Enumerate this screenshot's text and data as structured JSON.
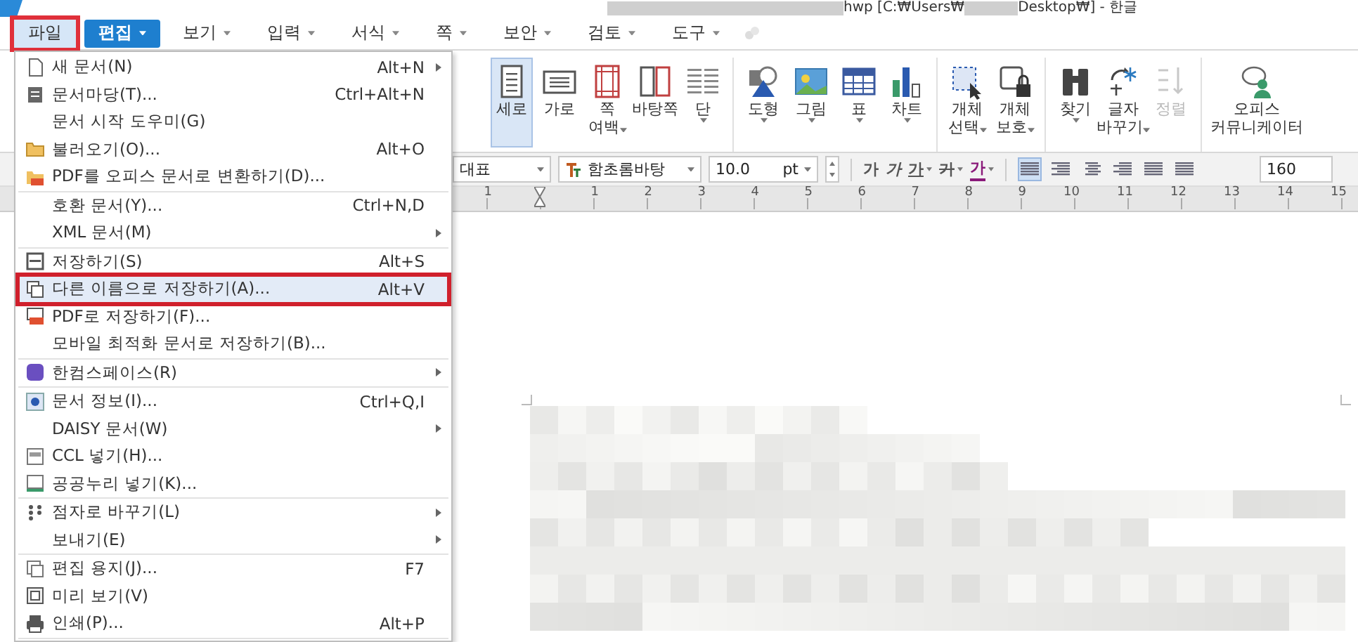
{
  "window": {
    "title_parts": [
      "hwp [C:₩Users₩",
      "Desktop₩] - 한글"
    ]
  },
  "menu_bar": [
    {
      "label": "파일",
      "selected": false,
      "open": true,
      "dropdown": false,
      "annotated": true
    },
    {
      "label": "편집",
      "selected": true,
      "open": false,
      "dropdown": true,
      "annotated": false
    },
    {
      "label": "보기",
      "selected": false,
      "open": false,
      "dropdown": true,
      "annotated": false
    },
    {
      "label": "입력",
      "selected": false,
      "open": false,
      "dropdown": true,
      "annotated": false
    },
    {
      "label": "서식",
      "selected": false,
      "open": false,
      "dropdown": true,
      "annotated": false
    },
    {
      "label": "쪽",
      "selected": false,
      "open": false,
      "dropdown": true,
      "annotated": false
    },
    {
      "label": "보안",
      "selected": false,
      "open": false,
      "dropdown": true,
      "annotated": false
    },
    {
      "label": "검토",
      "selected": false,
      "open": false,
      "dropdown": true,
      "annotated": false
    },
    {
      "label": "도구",
      "selected": false,
      "open": false,
      "dropdown": true,
      "annotated": false
    }
  ],
  "ribbon": {
    "groups": [
      [
        {
          "lines": [
            "세로"
          ],
          "dropdown": false,
          "selected": true,
          "disabled": false
        },
        {
          "lines": [
            "가로"
          ],
          "dropdown": false,
          "selected": false,
          "disabled": false
        },
        {
          "lines": [
            "쪽",
            "여백"
          ],
          "dropdown": true,
          "selected": false,
          "disabled": false
        },
        {
          "lines": [
            "바탕쪽"
          ],
          "dropdown": false,
          "selected": false,
          "disabled": false
        },
        {
          "lines": [
            "단"
          ],
          "dropdown": true,
          "selected": false,
          "disabled": false
        }
      ],
      [
        {
          "lines": [
            "도형"
          ],
          "dropdown": true,
          "selected": false,
          "disabled": false
        },
        {
          "lines": [
            "그림"
          ],
          "dropdown": true,
          "selected": false,
          "disabled": false
        },
        {
          "lines": [
            "표"
          ],
          "dropdown": true,
          "selected": false,
          "disabled": false
        },
        {
          "lines": [
            "차트"
          ],
          "dropdown": true,
          "selected": false,
          "disabled": false
        }
      ],
      [
        {
          "lines": [
            "개체",
            "선택"
          ],
          "dropdown": true,
          "selected": false,
          "disabled": false
        },
        {
          "lines": [
            "개체",
            "보호"
          ],
          "dropdown": true,
          "selected": false,
          "disabled": false
        }
      ],
      [
        {
          "lines": [
            "찾기"
          ],
          "dropdown": true,
          "selected": false,
          "disabled": false
        },
        {
          "lines": [
            "글자",
            "바꾸기"
          ],
          "dropdown": true,
          "selected": false,
          "disabled": false
        },
        {
          "lines": [
            "정렬"
          ],
          "dropdown": false,
          "selected": false,
          "disabled": true
        }
      ],
      [
        {
          "lines": [
            "오피스",
            "커뮤니케이터"
          ],
          "dropdown": false,
          "selected": false,
          "disabled": false
        }
      ]
    ]
  },
  "format_bar": {
    "style": "대표",
    "font": "함초롬바탕",
    "size": "10.0",
    "unit": "pt",
    "char_buttons": [
      {
        "label": "가",
        "kind": "bold",
        "dropdown": false
      },
      {
        "label": "가",
        "kind": "italic",
        "dropdown": false
      },
      {
        "label": "가",
        "kind": "underline",
        "dropdown": true
      },
      {
        "label": "가",
        "kind": "strike",
        "dropdown": true
      },
      {
        "label": "가",
        "kind": "color",
        "dropdown": true
      }
    ],
    "align_buttons": [
      {
        "selected": true
      },
      {
        "selected": false
      },
      {
        "selected": false
      },
      {
        "selected": false
      },
      {
        "selected": false
      },
      {
        "selected": false
      }
    ],
    "line_spacing": "160"
  },
  "ruler": {
    "marks": [
      {
        "kind": "number",
        "label": "1"
      },
      {
        "kind": "indent"
      },
      {
        "kind": "number",
        "label": "1"
      },
      {
        "kind": "number",
        "label": "2"
      },
      {
        "kind": "number",
        "label": "3"
      },
      {
        "kind": "number",
        "label": "4"
      },
      {
        "kind": "number",
        "label": "5"
      },
      {
        "kind": "number",
        "label": "6"
      },
      {
        "kind": "number",
        "label": "7"
      },
      {
        "kind": "number",
        "label": "8"
      },
      {
        "kind": "number",
        "label": "9"
      },
      {
        "kind": "number",
        "label": "10"
      },
      {
        "kind": "number",
        "label": "11"
      },
      {
        "kind": "number",
        "label": "12"
      },
      {
        "kind": "number",
        "label": "13"
      },
      {
        "kind": "number",
        "label": "14"
      },
      {
        "kind": "number",
        "label": "15"
      }
    ]
  },
  "file_menu": {
    "sections": [
      [
        {
          "label": "새 문서(N)",
          "shortcut": "Alt+N",
          "submenu": true,
          "highlighted": false,
          "annotated": false
        },
        {
          "label": "문서마당(T)...",
          "shortcut": "Ctrl+Alt+N",
          "submenu": false,
          "highlighted": false,
          "annotated": false
        },
        {
          "label": "문서 시작 도우미(G)",
          "submenu": false,
          "highlighted": false,
          "annotated": false
        },
        {
          "label": "불러오기(O)...",
          "shortcut": "Alt+O",
          "submenu": false,
          "highlighted": false,
          "annotated": false
        },
        {
          "label": "PDF를 오피스 문서로 변환하기(D)...",
          "submenu": false,
          "highlighted": false,
          "annotated": false
        }
      ],
      [
        {
          "label": "호환 문서(Y)...",
          "shortcut": "Ctrl+N,D",
          "submenu": false,
          "highlighted": false,
          "annotated": false
        },
        {
          "label": "XML 문서(M)",
          "submenu": true,
          "highlighted": false,
          "annotated": false
        }
      ],
      [
        {
          "label": "저장하기(S)",
          "shortcut": "Alt+S",
          "submenu": false,
          "highlighted": false,
          "annotated": false
        },
        {
          "label": "다른 이름으로 저장하기(A)...",
          "shortcut": "Alt+V",
          "submenu": false,
          "highlighted": true,
          "annotated": true
        },
        {
          "label": "PDF로 저장하기(F)...",
          "submenu": false,
          "highlighted": false,
          "annotated": false
        },
        {
          "label": "모바일 최적화 문서로 저장하기(B)...",
          "submenu": false,
          "highlighted": false,
          "annotated": false
        }
      ],
      [
        {
          "label": "한컴스페이스(R)",
          "submenu": true,
          "highlighted": false,
          "annotated": false
        }
      ],
      [
        {
          "label": "문서 정보(I)...",
          "shortcut": "Ctrl+Q,I",
          "submenu": false,
          "highlighted": false,
          "annotated": false
        },
        {
          "label": "DAISY 문서(W)",
          "submenu": true,
          "highlighted": false,
          "annotated": false
        },
        {
          "label": "CCL 넣기(H)...",
          "submenu": false,
          "highlighted": false,
          "annotated": false
        },
        {
          "label": "공공누리 넣기(K)...",
          "submenu": false,
          "highlighted": false,
          "annotated": false
        }
      ],
      [
        {
          "label": "점자로 바꾸기(L)",
          "submenu": true,
          "highlighted": false,
          "annotated": false
        },
        {
          "label": "보내기(E)",
          "submenu": true,
          "highlighted": false,
          "annotated": false
        }
      ],
      [
        {
          "label": "편집 용지(J)...",
          "shortcut": "F7",
          "submenu": false,
          "highlighted": false,
          "annotated": false
        },
        {
          "label": "미리 보기(V)",
          "submenu": false,
          "highlighted": false,
          "annotated": false
        },
        {
          "label": "인쇄(P)...",
          "shortcut": "Alt+P",
          "submenu": false,
          "highlighted": false,
          "annotated": false
        }
      ]
    ]
  }
}
